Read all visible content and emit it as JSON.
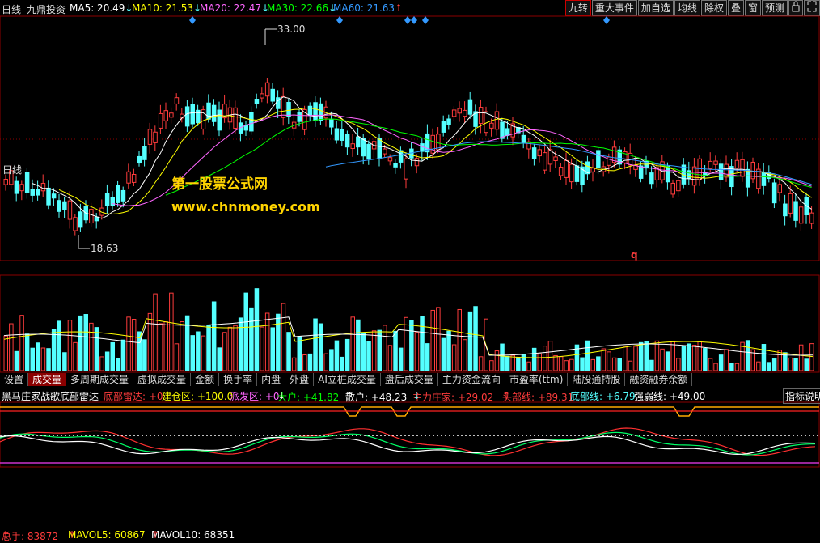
{
  "header": {
    "period": "日线",
    "stock_name": "九鼎投资",
    "ma5": "MA5: 20.49",
    "ma10": "MA10: 21.53",
    "ma20": "MA20: 22.47",
    "ma30": "MA30: 22.66",
    "ma60": "MA60: 21.63"
  },
  "toolbar": {
    "jiuzhuan": "九转",
    "events": "重大事件",
    "add_watch": "加自选",
    "ma_line": "均线",
    "exright": "除权",
    "overlay": "叠",
    "window": "窗",
    "forecast": "预测"
  },
  "price_chart": {
    "high_label": "33.00",
    "low_label": "18.63",
    "left_tag": "日线",
    "q_mark": "q"
  },
  "volume_header": {
    "total": "总手: 83872",
    "mavol5": "MAVOL5: 60867",
    "mavol10": "MAVOL10: 68351"
  },
  "tabs": [
    "设置",
    "成交量",
    "多周期成交量",
    "虚拟成交量",
    "金额",
    "换手率",
    "内盘",
    "外盘",
    "AI立桩成交量",
    "盘后成交量",
    "主力资金流向",
    "市盈率(ttm)",
    "陆股通持股",
    "融资融券余额"
  ],
  "active_tab": 1,
  "indicator": {
    "name": "黑马庄家战歌底部雷达",
    "radar": "底部雷达: +0",
    "build": "建仓区: +100.0",
    "launch": "派发区: +0",
    "big": "大户: +41.82",
    "retail": "散户: +48.23",
    "main": "主力庄家: +29.02",
    "top": "头部线: +89.31",
    "bottom": "底部线: +6.79",
    "strong": "强弱线: +49.00",
    "help": "指标说明"
  },
  "watermark": {
    "line1": "第一股票公式网",
    "line2": "www.chnmoney.com"
  },
  "colors": {
    "up": "#ff3c3c",
    "down": "#54ffff",
    "ma5": "#ffffff",
    "ma10": "#ffff00",
    "ma20": "#ff66ff",
    "ma30": "#00ff00",
    "ma60": "#3399ff"
  }
}
